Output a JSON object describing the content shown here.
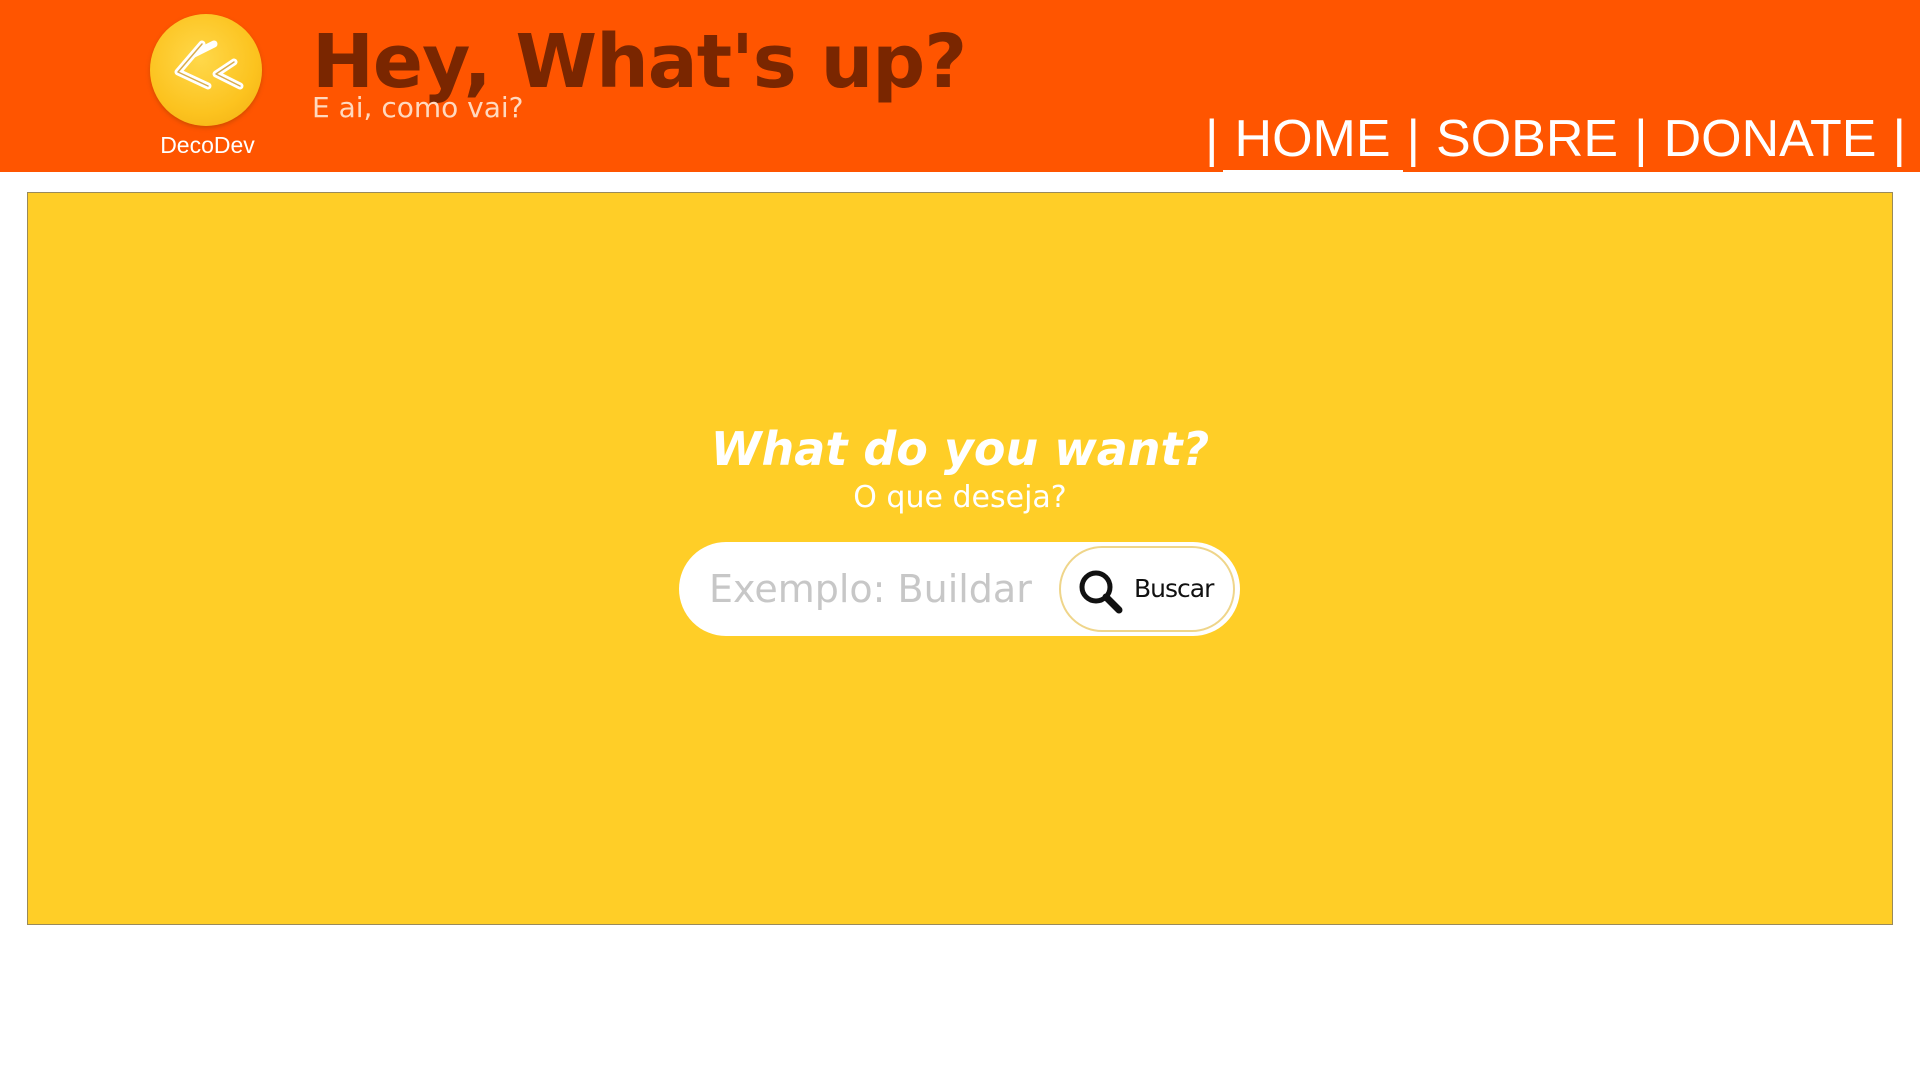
{
  "header": {
    "logo_caption": "DecoDev",
    "title": "Hey, What's up?",
    "subtitle": "E ai, como vai?",
    "logo_icon": "decodev-logo-icon",
    "background_color": "#ff5500"
  },
  "nav": {
    "separator": "|",
    "items": [
      {
        "label": "HOME",
        "active": true
      },
      {
        "label": "SOBRE",
        "active": false
      },
      {
        "label": "DONATE",
        "active": false
      }
    ]
  },
  "main": {
    "background_color": "#ffce27",
    "title": "What do you want?",
    "subtitle": "O que deseja?",
    "search": {
      "placeholder": "Exemplo: Buildar",
      "value": "",
      "button_label": "Buscar",
      "button_icon": "search-icon"
    }
  }
}
